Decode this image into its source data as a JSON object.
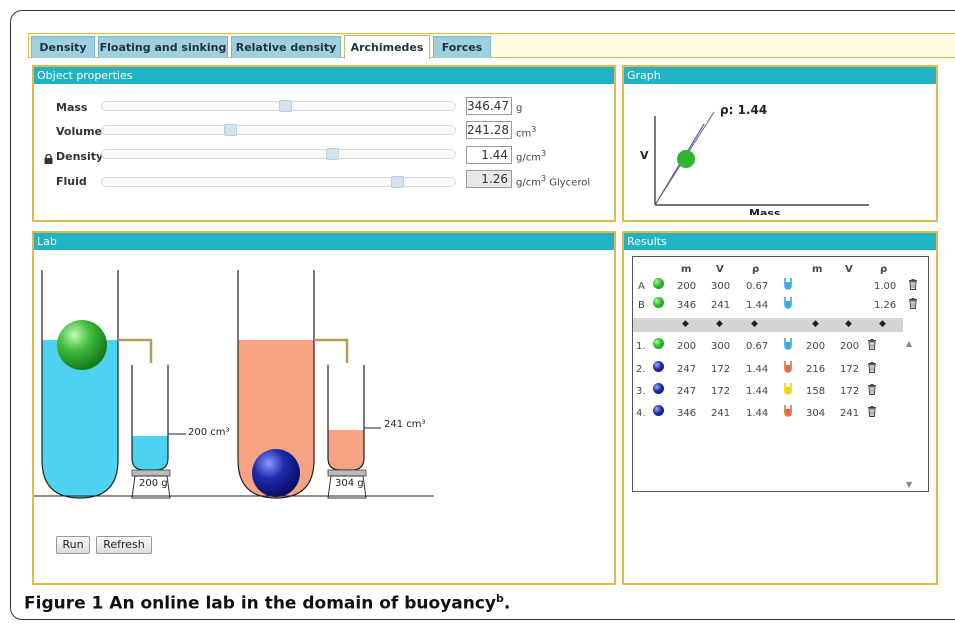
{
  "tabs": [
    {
      "label": "Density"
    },
    {
      "label": "Floating and sinking"
    },
    {
      "label": "Relative density"
    },
    {
      "label": "Archimedes"
    },
    {
      "label": "Forces"
    }
  ],
  "object_properties": {
    "title": "Object properties",
    "mass": {
      "label": "Mass",
      "value": "346.47",
      "unit": "g",
      "slider_level": 0.52
    },
    "volume": {
      "label": "Volume",
      "value": "241.28",
      "unit": "cm",
      "unit_sup": "3",
      "slider_level": 0.36
    },
    "density": {
      "label": "Density",
      "value": "1.44",
      "unit": "g/cm",
      "unit_sup": "3",
      "slider_level": 0.66
    },
    "fluid": {
      "label": "Fluid",
      "value": "1.26",
      "unit": "g/cm",
      "unit_sup": "3",
      "unit_suffix": " Glycerol",
      "slider_level": 0.85
    }
  },
  "graph": {
    "title": "Graph",
    "rho_label": "ρ: 1.44",
    "y_axis_label": "V",
    "x_axis_label": "Mass"
  },
  "lab": {
    "title": "Lab",
    "left_overflow_label": "200 cm³",
    "left_scale_label": "200 g",
    "right_overflow_label": "241 cm³",
    "right_scale_label": "304 g",
    "run_label": "Run",
    "refresh_label": "Refresh"
  },
  "results": {
    "title": "Results",
    "header": [
      "m",
      "V",
      "ρ",
      "m",
      "V",
      "ρ"
    ],
    "references": [
      {
        "id": "A",
        "ball": "green",
        "m": "200",
        "V": "300",
        "rho": "0.67",
        "tube": "blue",
        "fluid_rho": "1.00"
      },
      {
        "id": "B",
        "ball": "green",
        "m": "346",
        "V": "241",
        "rho": "1.44",
        "tube": "blue",
        "fluid_rho": "1.26"
      }
    ],
    "rows": [
      {
        "id": "1.",
        "ball": "green",
        "m": "200",
        "V": "300",
        "rho": "0.67",
        "tube": "blue",
        "m2": "200",
        "V2": "200"
      },
      {
        "id": "2.",
        "ball": "blue",
        "m": "247",
        "V": "172",
        "rho": "1.44",
        "tube": "orange",
        "m2": "216",
        "V2": "172"
      },
      {
        "id": "3.",
        "ball": "blue",
        "m": "247",
        "V": "172",
        "rho": "1.44",
        "tube": "yellow",
        "m2": "158",
        "V2": "172"
      },
      {
        "id": "4.",
        "ball": "blue",
        "m": "346",
        "V": "241",
        "rho": "1.44",
        "tube": "orange",
        "m2": "304",
        "V2": "241"
      }
    ]
  },
  "caption": {
    "text": "Figure 1 An online lab in the domain of buoyancy",
    "superscript": "b",
    "end": "."
  },
  "colors": {
    "panel_border": "#e6b84a",
    "panel_header": "#1fb3c4",
    "water": "#4dd3ef",
    "glycerol": "#f5a383",
    "tube_blue": "#3aa7e8",
    "tube_orange": "#e06a3a",
    "tube_yellow": "#f2d400"
  }
}
